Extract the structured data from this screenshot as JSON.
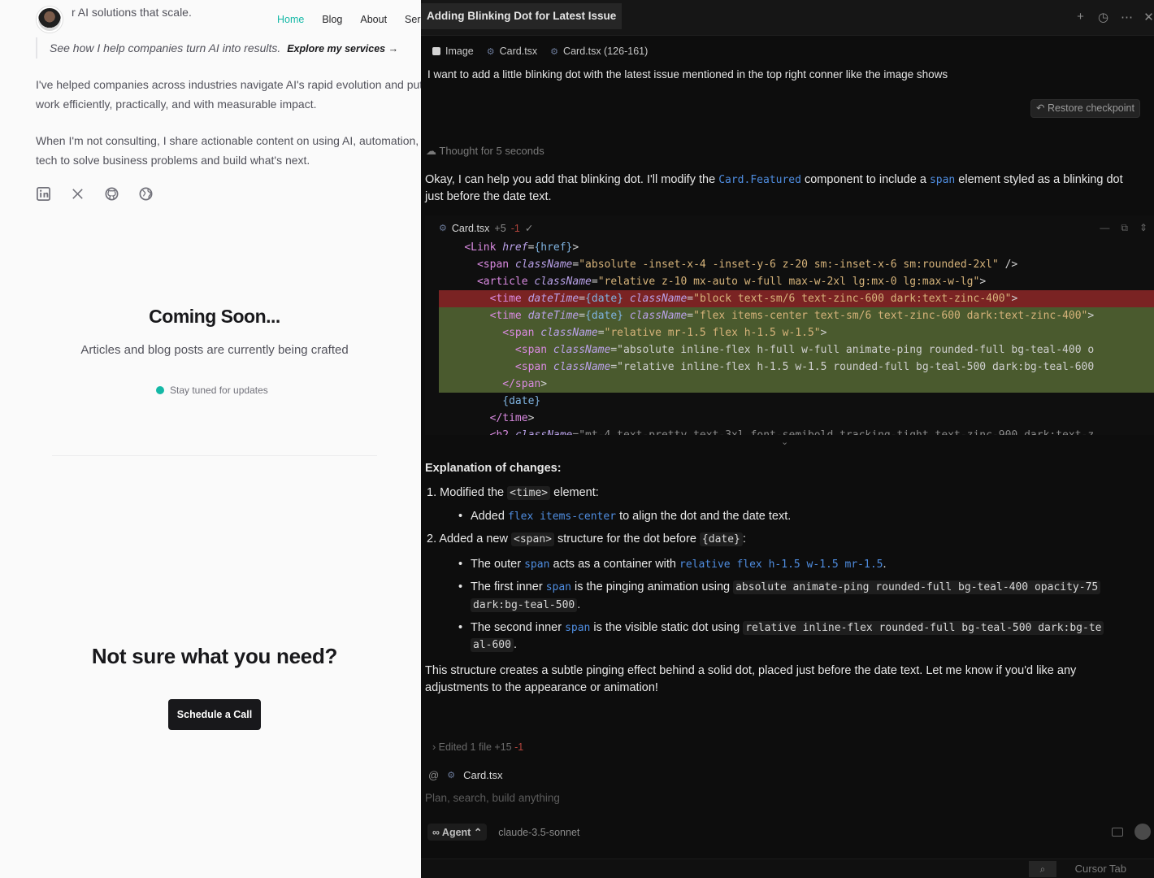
{
  "site": {
    "tagline_text": "r AI solutions that scale.",
    "nav": [
      "Home",
      "Blog",
      "About",
      "Ser"
    ],
    "quote_text": "See how I help companies turn AI into results.",
    "quote_link": "Explore my services →",
    "para1": "I've helped companies across industries navigate AI's rapid evolution and put it to work efficiently, practically, and with measurable impact.",
    "para2": "When I'm not consulting, I share actionable content on using AI, automation, and tech to solve business problems and build what's next.",
    "social_icons": [
      "linkedin-icon",
      "x-icon",
      "github-icon",
      "globe-icon"
    ],
    "coming_title": "Coming Soon...",
    "coming_sub": "Articles and blog posts are currently being crafted",
    "stay_tuned": "Stay tuned for updates",
    "not_sure": "Not sure what you need?",
    "cta": "Schedule a Call",
    "accent": "#14b8a6"
  },
  "panel": {
    "title": "Adding Blinking Dot for Latest Issue",
    "tool_icons": [
      "plus-icon",
      "history-icon",
      "more-icon",
      "close-icon"
    ],
    "context_chips": [
      "Image",
      "Card.tsx",
      "Card.tsx (126-161)"
    ],
    "user_message": "I want to add a little blinking dot with the latest issue mentioned in the top right conner like the image shows",
    "restore_label": "Restore checkpoint",
    "thought": "Thought for 5 seconds",
    "reply": {
      "p1": "Okay, I can help you add that blinking dot. I'll modify the",
      "c1": "Card.Featured",
      "p2": "component to include a",
      "c2": "span",
      "p3": "element styled as a",
      "p4": "blinking dot just before the date text."
    },
    "code": {
      "file": "Card.tsx",
      "added": "+5",
      "removed": "-1",
      "check": "✓",
      "lines": [
        {
          "kind": "plain",
          "text": "    <Link href={href}>"
        },
        {
          "kind": "plain",
          "text": "      <span className=\"absolute -inset-x-4 -inset-y-6 z-20 sm:-inset-x-6 sm:rounded-2xl\" />"
        },
        {
          "kind": "plain",
          "text": "      <article className=\"relative z-10 mx-auto w-full max-w-2xl lg:mx-0 lg:max-w-lg\">"
        },
        {
          "kind": "red",
          "text": "        <time dateTime={date} className=\"block text-sm/6 text-zinc-600 dark:text-zinc-400\">"
        },
        {
          "kind": "green",
          "text": "        <time dateTime={date} className=\"flex items-center text-sm/6 text-zinc-600 dark:text-zinc-400\">"
        },
        {
          "kind": "green",
          "text": "          <span className=\"relative mr-1.5 flex h-1.5 w-1.5\">"
        },
        {
          "kind": "green",
          "text": "            <span className=\"absolute inline-flex h-full w-full animate-ping rounded-full bg-teal-400 o"
        },
        {
          "kind": "green",
          "text": "            <span className=\"relative inline-flex h-1.5 w-1.5 rounded-full bg-teal-500 dark:bg-teal-600"
        },
        {
          "kind": "green",
          "text": "          </span>"
        },
        {
          "kind": "plain",
          "text": "          {date}"
        },
        {
          "kind": "plain",
          "text": "        </time>"
        },
        {
          "kind": "ghost",
          "text": "        <h2 className=\"mt-4 text-pretty text-3xl font-semibold tracking-tight text-zinc-900 dark:text-z"
        }
      ]
    },
    "explanation": {
      "heading": "Explanation of changes:",
      "item1_prefix": "1. Modified the",
      "item1_code": "<time>",
      "item1_suffix": "element:",
      "b1_prefix": "Added",
      "b1_code": "flex items-center",
      "b1_suffix": "to align the dot and the date text.",
      "item2_prefix": "2. Added a new",
      "item2_code1": "<span>",
      "item2_mid": "structure for the dot before",
      "item2_code2": "{date}",
      "item2_suffix": ":",
      "b2_prefix": "The outer",
      "b2_code1": "span",
      "b2_mid": "acts as a container with",
      "b2_code2": "relative flex h-1.5 w-1.5 mr-1.5",
      "b2_suffix": ".",
      "b3_prefix": "The first inner",
      "b3_code1": "span",
      "b3_mid": "is the pinging animation using",
      "b3_code2": "absolute animate-ping rounded-full bg-teal-400 opacity-75",
      "b3_code3": "dark:bg-teal-500",
      "b3_suffix": ".",
      "b4_prefix": "The second inner",
      "b4_code1": "span",
      "b4_mid": "is the visible static dot using",
      "b4_code2": "relative inline-flex rounded-full bg-teal-500 dark:bg-te",
      "b4_code3": "al-600",
      "b4_suffix": ".",
      "closing1": "This structure creates a subtle pinging effect behind a solid dot, placed just before the date text. Let me know if you'd like any",
      "closing2": "adjustments to the appearance or animation!"
    },
    "edited": "Edited 1 file +15",
    "edited_del": "-1",
    "composer_chip": "Card.tsx",
    "composer_placeholder": "Plan, search, build anything",
    "mode": "Agent",
    "model": "claude-3.5-sonnet",
    "status_cursor_tab": "Cursor Tab"
  }
}
